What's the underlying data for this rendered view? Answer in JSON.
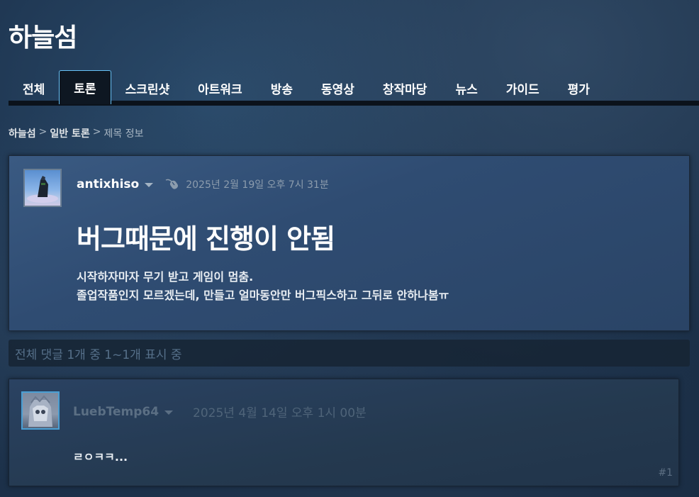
{
  "app": {
    "title": "하늘섬"
  },
  "tabs": [
    {
      "label": "전체"
    },
    {
      "label": "토론",
      "active": true
    },
    {
      "label": "스크린샷"
    },
    {
      "label": "아트워크"
    },
    {
      "label": "방송"
    },
    {
      "label": "동영상"
    },
    {
      "label": "창작마당"
    },
    {
      "label": "뉴스"
    },
    {
      "label": "가이드"
    },
    {
      "label": "평가"
    }
  ],
  "breadcrumb": {
    "items": [
      "하늘섬",
      "일반 토론",
      "제목 정보"
    ],
    "separator": ">"
  },
  "topic": {
    "author": "antixhiso",
    "author_icon": "mouse-icon",
    "timestamp": "2025년 2월 19일 오후 7시 31분",
    "title": "버그때문에 진행이 안됨",
    "body_line1": "시작하자마자 무기 받고 게임이 멈춤.",
    "body_line2": "졸업작품인지 모르겠는데, 만들고 얼마동안만 버그픽스하고 그뒤로 안하나봄ㅠ"
  },
  "comments": {
    "summary": "전체 댓글 1개 중 1~1개 표시 중"
  },
  "reply": {
    "author": "LuebTemp64",
    "timestamp": "2025년 4월 14일 오후 1시 00분",
    "body": "ㄹㅇㅋㅋ...",
    "index": "#1"
  },
  "colors": {
    "accent": "#67c1f5",
    "background": "#1e3550",
    "card": "#2f4c72"
  }
}
